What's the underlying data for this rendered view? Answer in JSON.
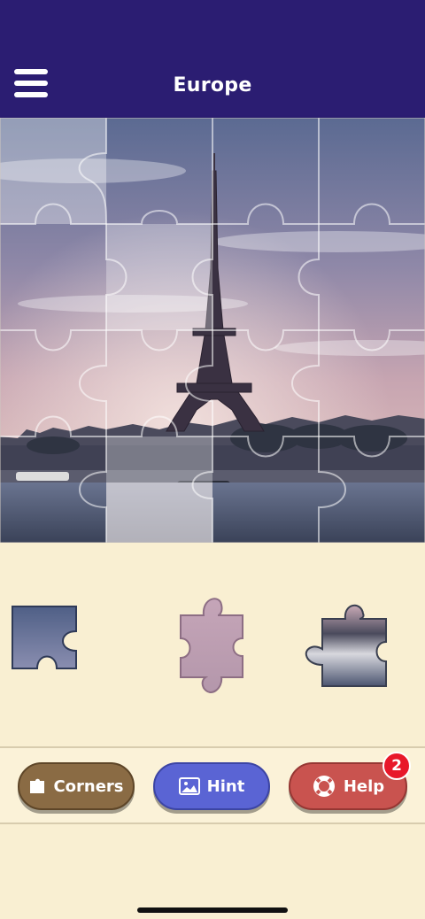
{
  "header": {
    "title": "Europe",
    "background": "#2b1d72"
  },
  "board": {
    "grid": "4x4",
    "image_subject": "Eiffel Tower",
    "placed_pieces": 16
  },
  "tray": {
    "pieces": [
      {
        "shape": "corner",
        "icon": "corner-piece"
      },
      {
        "shape": "tabbed",
        "icon": "sky-piece"
      },
      {
        "shape": "tabbed",
        "icon": "river-piece"
      }
    ]
  },
  "toolbar": {
    "corners_label": "Corners",
    "hint_label": "Hint",
    "help_label": "Help",
    "help_badge": "2",
    "colors": {
      "corners": "#8a6b44",
      "hint": "#5a64d4",
      "help": "#c9534f",
      "badge": "#e8182a"
    }
  },
  "background": "#f9efd2"
}
